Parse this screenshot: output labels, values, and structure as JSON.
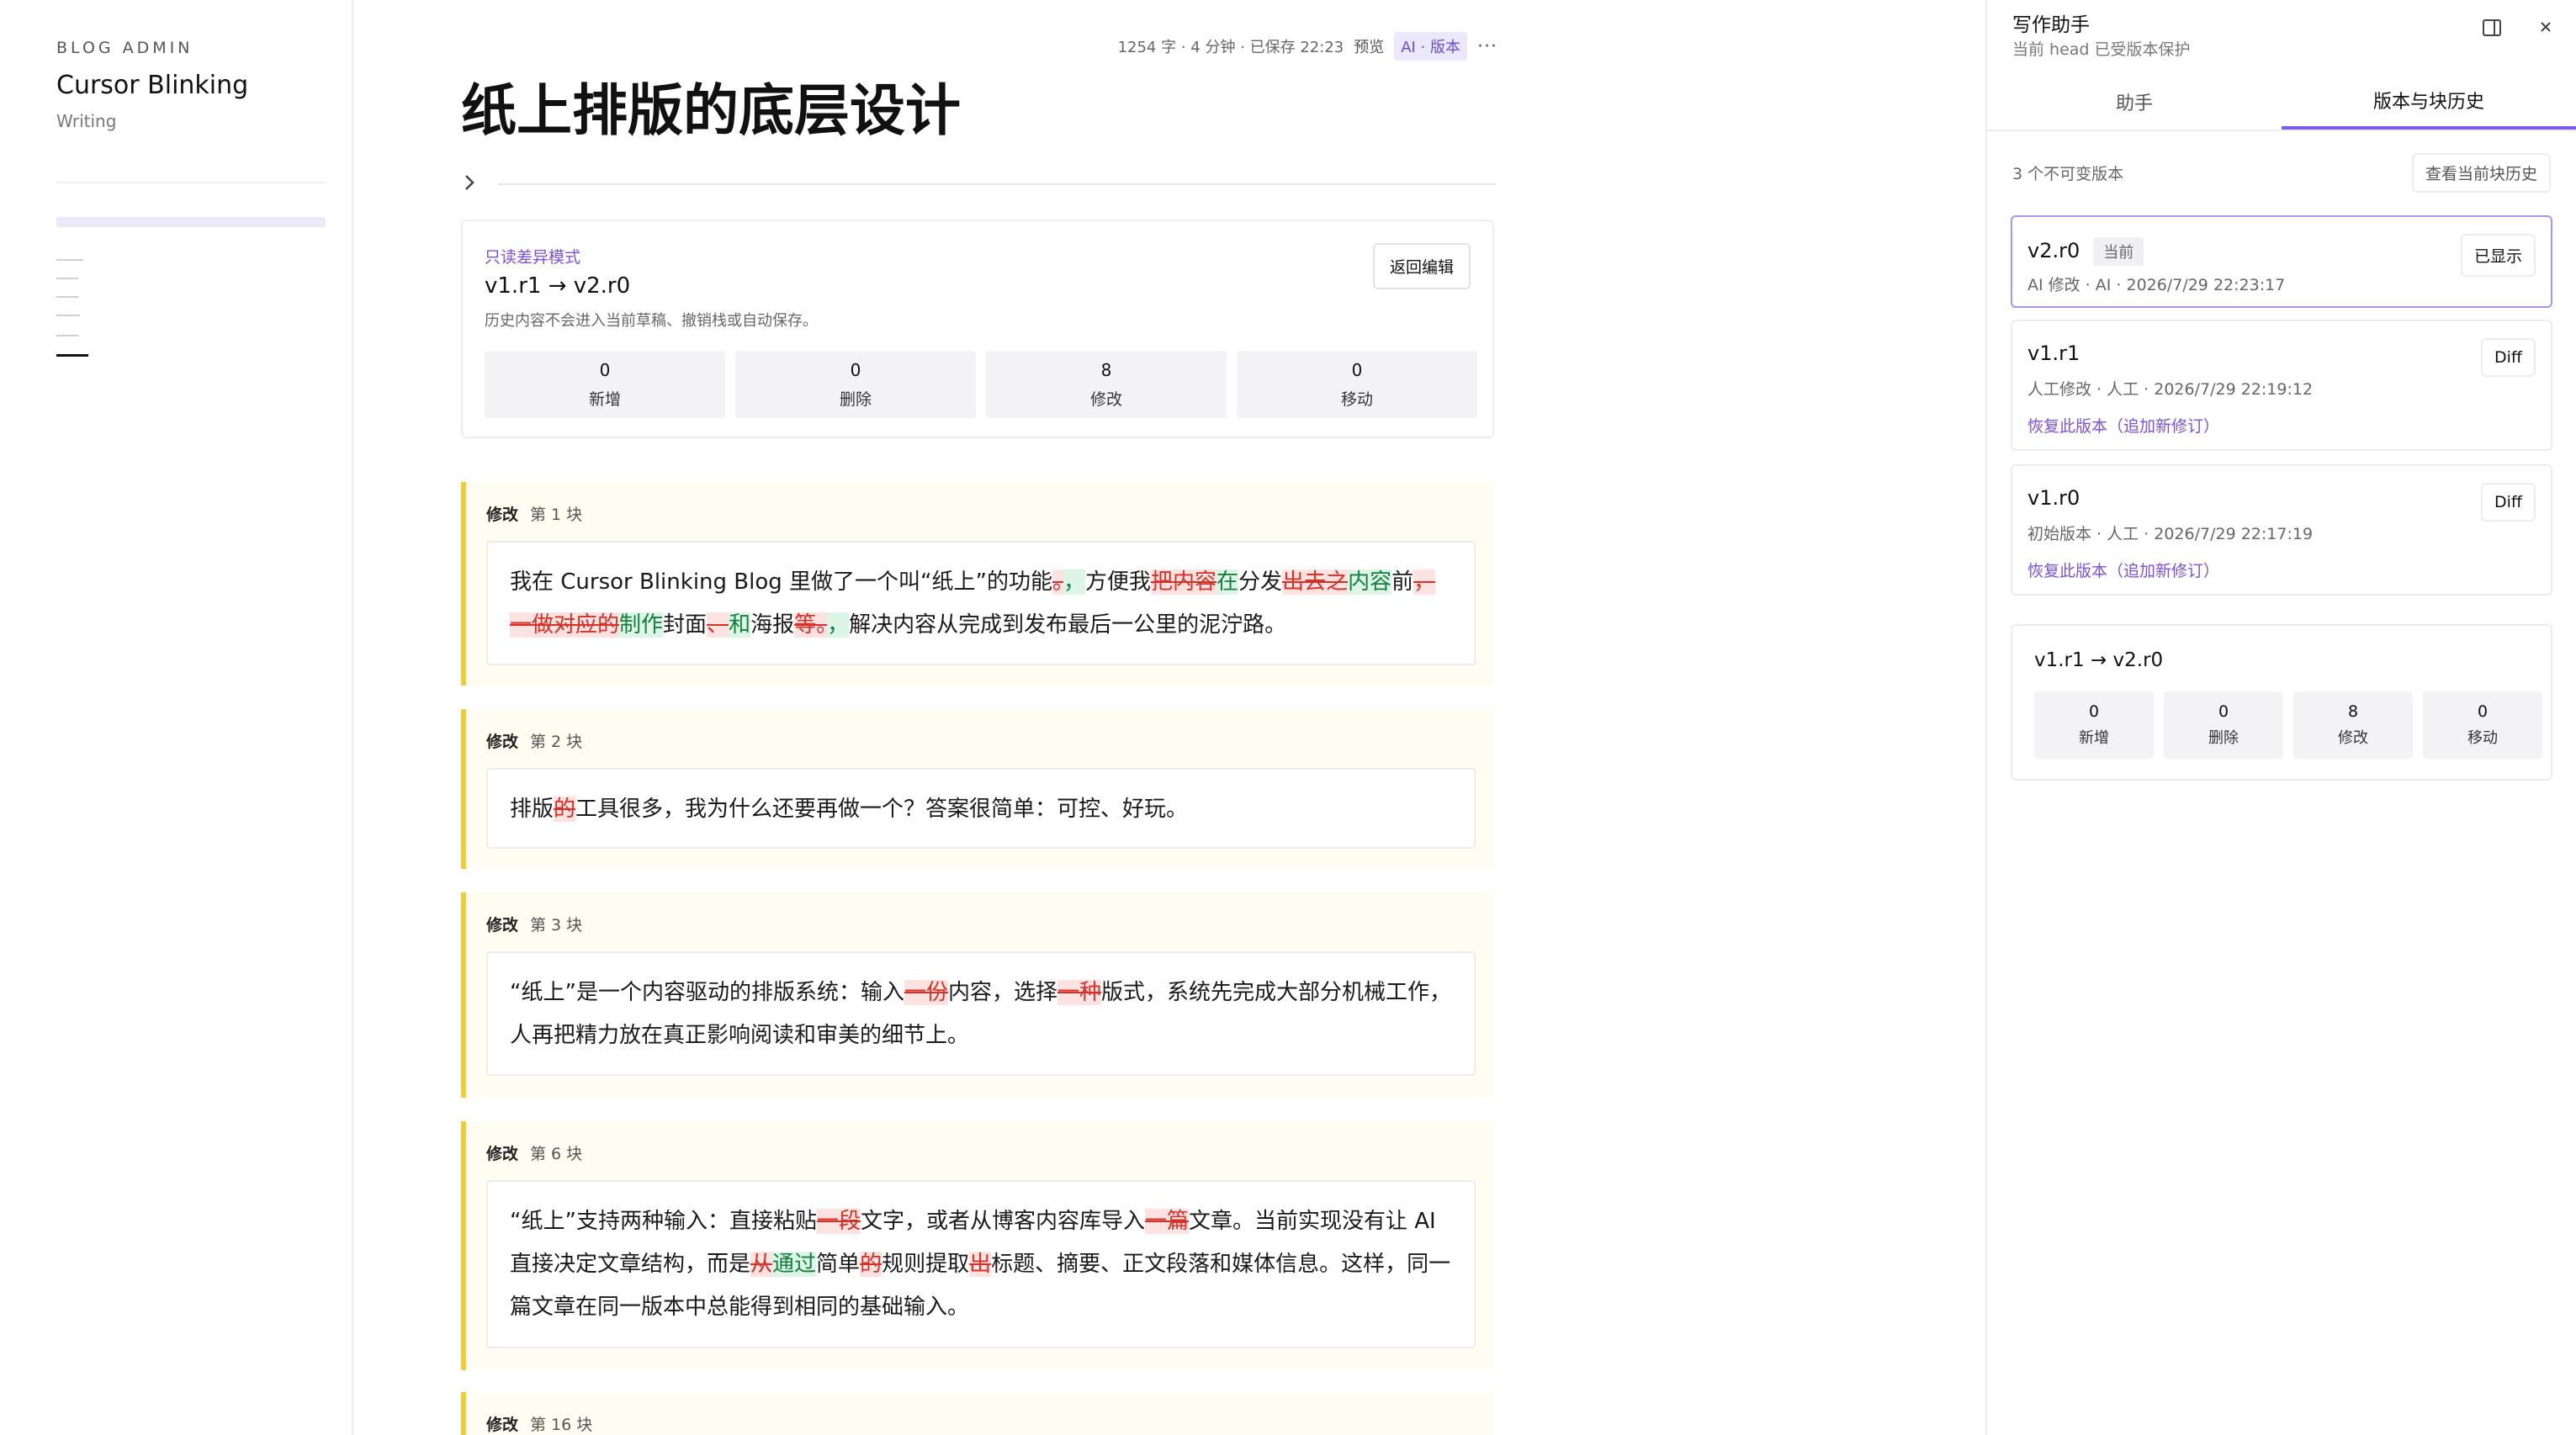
{
  "sidebar": {
    "kicker": "BLOG ADMIN",
    "title": "Cursor Blinking",
    "subtitle": "Writing"
  },
  "editor": {
    "meta_stats": "1254 字 · 4 分钟 · 已保存 22:23",
    "preview_label": "预览",
    "mode_badge": "AI · 版本",
    "more_label": "···",
    "title": "纸上排版的底层设计",
    "diff_panel": {
      "mode_label": "只读差异模式",
      "range": "v1.r1 → v2.r0",
      "note": "历史内容不会进入当前草稿、撤销栈或自动保存。",
      "back_button": "返回编辑",
      "stats": [
        {
          "num": "0",
          "label": "新增"
        },
        {
          "num": "0",
          "label": "删除"
        },
        {
          "num": "8",
          "label": "修改"
        },
        {
          "num": "0",
          "label": "移动"
        }
      ]
    },
    "blocks": [
      {
        "kind": "修改",
        "index": "第 1 块",
        "segments": [
          {
            "t": "我在 Cursor Blinking Blog 里做了一个叫“纸上”的功能"
          },
          {
            "t": "。",
            "c": "del"
          },
          {
            "t": "，",
            "c": "ins"
          },
          {
            "t": "方便我"
          },
          {
            "t": "把内容",
            "c": "del"
          },
          {
            "t": "在",
            "c": "ins"
          },
          {
            "t": "分发"
          },
          {
            "t": "出去之",
            "c": "del"
          },
          {
            "t": "内容",
            "c": "ins"
          },
          {
            "t": "前"
          },
          {
            "t": "，一做对应的",
            "c": "del"
          },
          {
            "t": "制作",
            "c": "ins"
          },
          {
            "t": "封面"
          },
          {
            "t": "、",
            "c": "del"
          },
          {
            "t": "和",
            "c": "ins"
          },
          {
            "t": "海报"
          },
          {
            "t": "等。",
            "c": "del"
          },
          {
            "t": "，",
            "c": "ins"
          },
          {
            "t": "解决内容从完成到发布最后一公里的泥泞路。"
          }
        ]
      },
      {
        "kind": "修改",
        "index": "第 2 块",
        "segments": [
          {
            "t": "排版"
          },
          {
            "t": "的",
            "c": "del"
          },
          {
            "t": "工具很多，我为什么还要再做一个？答案很简单：可控、好玩。"
          }
        ]
      },
      {
        "kind": "修改",
        "index": "第 3 块",
        "segments": [
          {
            "t": "“纸上”是一个内容驱动的排版系统：输入"
          },
          {
            "t": "一份",
            "c": "del"
          },
          {
            "t": "内容，选择"
          },
          {
            "t": "一种",
            "c": "del"
          },
          {
            "t": "版式，系统先完成大部分机械工作，人再把精力放在真正影响阅读和审美的细节上。"
          }
        ]
      },
      {
        "kind": "修改",
        "index": "第 6 块",
        "segments": [
          {
            "t": "“纸上”支持两种输入：直接粘贴"
          },
          {
            "t": "一段",
            "c": "del"
          },
          {
            "t": "文字，或者从博客内容库导入"
          },
          {
            "t": "一篇",
            "c": "del"
          },
          {
            "t": "文章。当前实现没有让 AI 直接决定文章结构，而是"
          },
          {
            "t": "从",
            "c": "del"
          },
          {
            "t": "通过",
            "c": "ins"
          },
          {
            "t": "简单"
          },
          {
            "t": "的",
            "c": "del"
          },
          {
            "t": "规则提取"
          },
          {
            "t": "出",
            "c": "del"
          },
          {
            "t": "标题、摘要、正文段落和媒体信息。这样，同一篇文章在同一版本中总能得到相同的基础输入。"
          }
        ]
      },
      {
        "kind": "修改",
        "index": "第 16 块",
        "segments": []
      }
    ]
  },
  "assistant": {
    "title": "写作助手",
    "subtitle": "当前 head 已受版本保护",
    "tabs": [
      "助手",
      "版本与块历史"
    ],
    "version_count": "3 个不可变版本",
    "history_button": "查看当前块历史",
    "versions": [
      {
        "name": "v2.r0",
        "tag": "当前",
        "meta": "AI 修改 · AI · 2026/7/29 22:23:17",
        "button": "已显示",
        "restore": ""
      },
      {
        "name": "v1.r1",
        "tag": "",
        "meta": "人工修改 · 人工 · 2026/7/29 22:19:12",
        "button": "Diff",
        "restore": "恢复此版本（追加新修订）"
      },
      {
        "name": "v1.r0",
        "tag": "",
        "meta": "初始版本 · 人工 · 2026/7/29 22:17:19",
        "button": "Diff",
        "restore": "恢复此版本（追加新修订）"
      }
    ],
    "compare": {
      "range": "v1.r1 → v2.r0",
      "stats": [
        {
          "num": "0",
          "label": "新增"
        },
        {
          "num": "0",
          "label": "删除"
        },
        {
          "num": "8",
          "label": "修改"
        },
        {
          "num": "0",
          "label": "移动"
        }
      ]
    }
  }
}
